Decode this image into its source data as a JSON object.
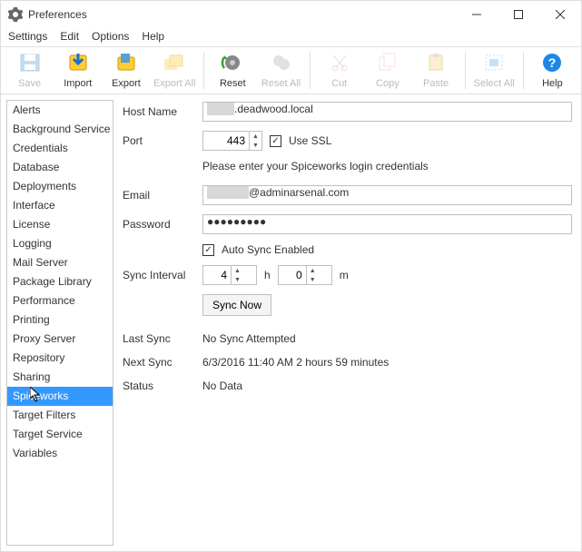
{
  "title": "Preferences",
  "menu": [
    "Settings",
    "Edit",
    "Options",
    "Help"
  ],
  "toolbar": [
    {
      "name": "save",
      "label": "Save",
      "enabled": false,
      "icon": "save"
    },
    {
      "name": "import",
      "label": "Import",
      "enabled": true,
      "icon": "import"
    },
    {
      "name": "export",
      "label": "Export",
      "enabled": true,
      "icon": "export"
    },
    {
      "name": "export-all",
      "label": "Export All",
      "enabled": false,
      "icon": "export-all"
    },
    {
      "sep": true
    },
    {
      "name": "reset",
      "label": "Reset",
      "enabled": true,
      "icon": "reset"
    },
    {
      "name": "reset-all",
      "label": "Reset All",
      "enabled": false,
      "icon": "reset-all"
    },
    {
      "sep": true
    },
    {
      "name": "cut",
      "label": "Cut",
      "enabled": false,
      "icon": "cut"
    },
    {
      "name": "copy",
      "label": "Copy",
      "enabled": false,
      "icon": "copy"
    },
    {
      "name": "paste",
      "label": "Paste",
      "enabled": false,
      "icon": "paste"
    },
    {
      "sep": true
    },
    {
      "name": "select-all",
      "label": "Select All",
      "enabled": false,
      "icon": "select-all"
    },
    {
      "sep": true
    },
    {
      "name": "help",
      "label": "Help",
      "enabled": true,
      "icon": "help"
    }
  ],
  "sidebar": {
    "items": [
      "Alerts",
      "Background Service",
      "Credentials",
      "Database",
      "Deployments",
      "Interface",
      "License",
      "Logging",
      "Mail Server",
      "Package Library",
      "Performance",
      "Printing",
      "Proxy Server",
      "Repository",
      "Sharing",
      "Spiceworks",
      "Target Filters",
      "Target Service",
      "Variables"
    ],
    "selected": "Spiceworks"
  },
  "form": {
    "hostname_label": "Host Name",
    "hostname_suffix": ".deadwood.local",
    "port_label": "Port",
    "port_value": "443",
    "use_ssl_label": "Use SSL",
    "use_ssl_checked": true,
    "cred_hint": "Please enter your Spiceworks login credentials",
    "email_label": "Email",
    "email_suffix": "@adminarsenal.com",
    "password_label": "Password",
    "password_value": "●●●●●●●●●",
    "autosync_label": "Auto Sync Enabled",
    "autosync_checked": true,
    "interval_label": "Sync Interval",
    "interval_h": "4",
    "interval_h_unit": "h",
    "interval_m": "0",
    "interval_m_unit": "m",
    "sync_now_label": "Sync Now",
    "last_sync_label": "Last Sync",
    "last_sync_value": "No Sync Attempted",
    "next_sync_label": "Next Sync",
    "next_sync_value": "6/3/2016 11:40 AM 2 hours 59 minutes",
    "status_label": "Status",
    "status_value": "No Data"
  }
}
